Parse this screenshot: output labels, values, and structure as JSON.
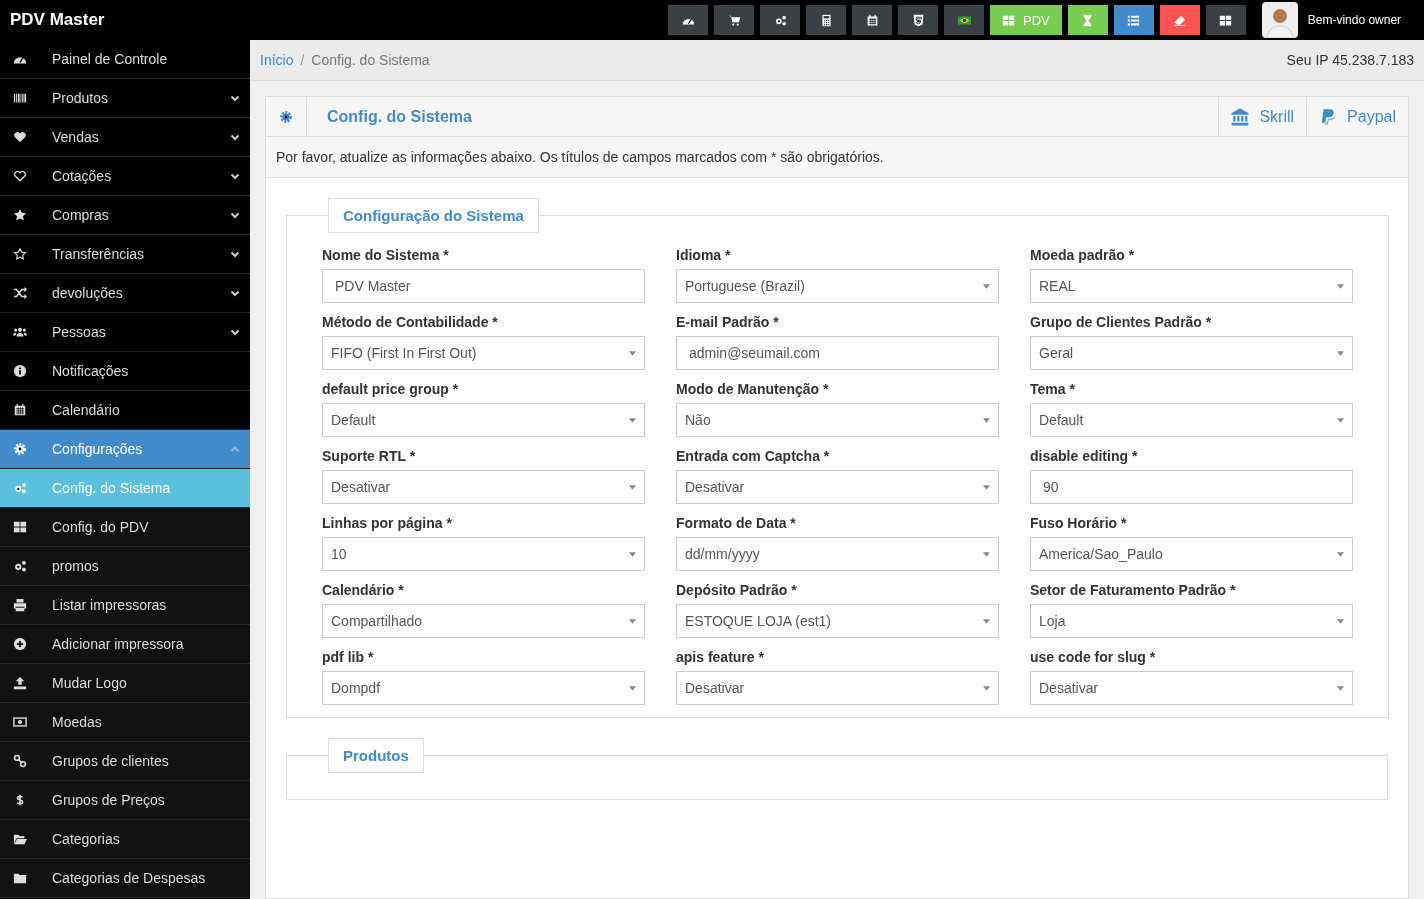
{
  "topbar": {
    "brand": "PDV Master",
    "buttons": [
      {
        "color": "#3b4045"
      },
      {
        "color": "#3b4045"
      },
      {
        "color": "#3b4045"
      },
      {
        "color": "#3b4045"
      },
      {
        "color": "#3b4045"
      },
      {
        "color": "#3b4045"
      },
      {
        "color": "#3b4045"
      },
      {
        "label": "PDV",
        "color": "#78cd51"
      },
      {
        "color": "#78cd51"
      },
      {
        "color": "#428bca"
      },
      {
        "color": "#ff5454"
      },
      {
        "color": "#3b4045"
      }
    ],
    "welcome": "Bem-vindo owner"
  },
  "sidebar": {
    "items": [
      {
        "label": "Painel de Controle",
        "selected": false
      },
      {
        "label": "Produtos",
        "expanded": false,
        "selected": false
      },
      {
        "label": "Vendas",
        "expanded": false,
        "selected": false
      },
      {
        "label": "Cotações",
        "expanded": false,
        "selected": false
      },
      {
        "label": "Compras",
        "expanded": false,
        "selected": false
      },
      {
        "label": "Transferências",
        "expanded": false,
        "selected": false
      },
      {
        "label": "devoluções",
        "expanded": false,
        "selected": false
      },
      {
        "label": "Pessoas",
        "expanded": false,
        "selected": false
      },
      {
        "label": "Notificações",
        "selected": false
      },
      {
        "label": "Calendário",
        "selected": false
      },
      {
        "label": "Configurações",
        "expanded": true,
        "selected": true,
        "children": [
          {
            "label": "Config. do Sistema",
            "selected": true
          },
          {
            "label": "Config. do PDV",
            "selected": false
          },
          {
            "label": "promos",
            "selected": false
          },
          {
            "label": "Listar impressoras",
            "selected": false
          },
          {
            "label": "Adicionar impressora",
            "selected": false
          },
          {
            "label": "Mudar Logo",
            "selected": false
          },
          {
            "label": "Moedas",
            "selected": false
          },
          {
            "label": "Grupos de clientes",
            "selected": false
          },
          {
            "label": "Grupos de Preços",
            "selected": false
          },
          {
            "label": "Categorias",
            "selected": false
          },
          {
            "label": "Categorias de Despesas",
            "selected": false
          }
        ]
      }
    ]
  },
  "breadcrumb": {
    "items": [
      "Início",
      "Config. do Sistema"
    ],
    "separator": "/",
    "ip": "Seu IP 45.238.7.183"
  },
  "panel": {
    "title": "Config. do Sistema",
    "links": [
      "Skrill",
      "Paypal"
    ],
    "notice": "Por favor, atualize as informações abaixo. Os títulos de campos marcados com * são obrigatórios.",
    "sections": [
      {
        "legend": "Configuração do Sistema",
        "fields": [
          {
            "label": "Nome do Sistema *",
            "kind": "text",
            "value": "PDV Master"
          },
          {
            "label": "Idioma *",
            "kind": "select",
            "value": "Portuguese (Brazil)"
          },
          {
            "label": "Moeda padrão *",
            "kind": "select",
            "value": "REAL"
          },
          {
            "label": "Método de Contabilidade *",
            "kind": "select",
            "value": "FIFO (First In First Out)"
          },
          {
            "label": "E-mail Padrão *",
            "kind": "text",
            "value": "admin@seumail.com"
          },
          {
            "label": "Grupo de Clientes Padrão *",
            "kind": "select",
            "value": "Geral"
          },
          {
            "label": "default price group *",
            "kind": "select",
            "value": "Default"
          },
          {
            "label": "Modo de Manutenção *",
            "kind": "select",
            "value": "Não"
          },
          {
            "label": "Tema *",
            "kind": "select",
            "value": "Default"
          },
          {
            "label": "Suporte RTL *",
            "kind": "select",
            "value": "Desativar"
          },
          {
            "label": "Entrada com Captcha *",
            "kind": "select",
            "value": "Desativar"
          },
          {
            "label": "disable editing *",
            "kind": "text",
            "value": "90"
          },
          {
            "label": "Linhas por página *",
            "kind": "select",
            "value": "10"
          },
          {
            "label": "Formato de Data *",
            "kind": "select",
            "value": "dd/mm/yyyy"
          },
          {
            "label": "Fuso Horário *",
            "kind": "select",
            "value": "America/Sao_Paulo"
          },
          {
            "label": "Calendário *",
            "kind": "select",
            "value": "Compartilhado"
          },
          {
            "label": "Depósito Padrão *",
            "kind": "select",
            "value": "ESTOQUE LOJA (est1)"
          },
          {
            "label": "Setor de Faturamento Padrão *",
            "kind": "select",
            "value": "Loja"
          },
          {
            "label": "pdf lib *",
            "kind": "select",
            "value": "Dompdf"
          },
          {
            "label": "apis feature *",
            "kind": "select",
            "value": "Desativar"
          },
          {
            "label": "use code for slug *",
            "kind": "select",
            "value": "Desativar"
          }
        ]
      },
      {
        "legend": "Produtos"
      }
    ]
  }
}
